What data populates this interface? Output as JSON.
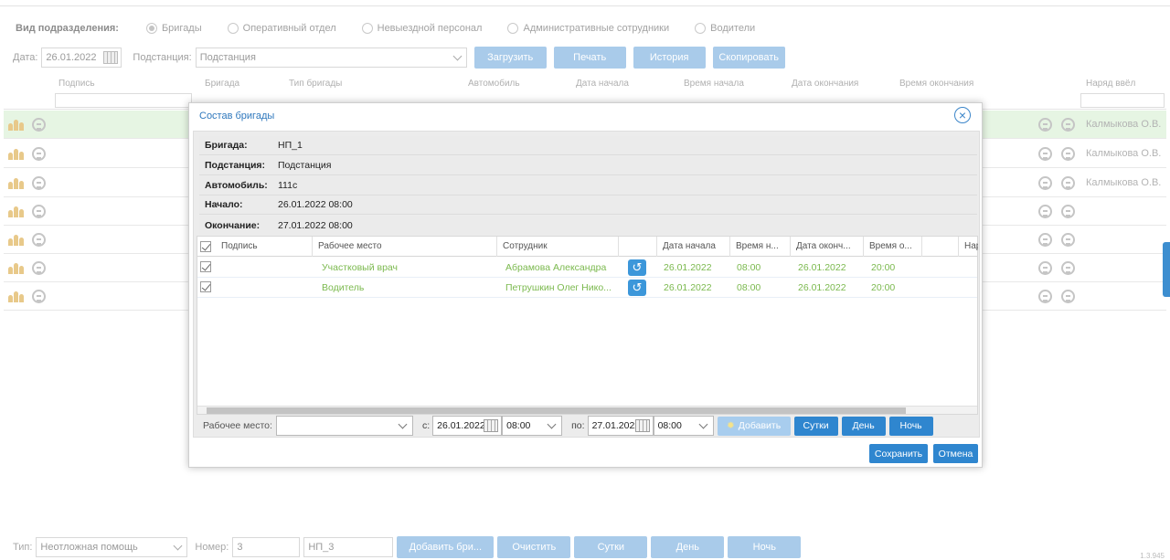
{
  "background": {
    "unit_type_label": "Вид подразделения:",
    "unit_types": [
      {
        "label": "Бригады",
        "selected": true
      },
      {
        "label": "Оперативный отдел",
        "selected": false
      },
      {
        "label": "Невыездной персонал",
        "selected": false
      },
      {
        "label": "Административные сотрудники",
        "selected": false
      },
      {
        "label": "Водители",
        "selected": false
      }
    ],
    "date_label": "Дата:",
    "date_value": "26.01.2022",
    "station_label": "Подстанция:",
    "station_value": "Подстанция",
    "buttons": {
      "load": "Загрузить",
      "print": "Печать",
      "history": "История",
      "copy": "Скопировать"
    },
    "columns": {
      "signature": "Подпись",
      "brigade": "Бригада",
      "brigade_type": "Тип бригады",
      "car": "Автомобиль",
      "start_date": "Дата начала",
      "start_time": "Время начала",
      "end_date": "Дата окончания",
      "end_time": "Время окончания",
      "issued_by": "Наряд ввёл"
    },
    "row_names": [
      "Калмыкова О.В.",
      "Калмыкова О.В.",
      "Калмыкова О.В.",
      "",
      "",
      "",
      ""
    ],
    "bottom": {
      "type_label": "Тип:",
      "type_value": "Неотложная помощь",
      "number_label": "Номер:",
      "number_value": "3",
      "code_value": "НП_3",
      "add_brigade": "Добавить бри...",
      "clear": "Очистить",
      "day24": "Сутки",
      "day": "День",
      "night": "Ночь"
    },
    "version": "1.3.945"
  },
  "modal": {
    "title": "Состав бригады",
    "info": [
      {
        "key": "Бригада:",
        "value": "НП_1"
      },
      {
        "key": "Подстанция:",
        "value": "Подстанция"
      },
      {
        "key": "Автомобиль:",
        "value": "111с"
      },
      {
        "key": "Начало:",
        "value": "26.01.2022 08:00"
      },
      {
        "key": "Окончание:",
        "value": "27.01.2022 08:00"
      }
    ],
    "table_headers": {
      "signature": "Подпись",
      "workplace": "Рабочее место",
      "employee": "Сотрудник",
      "start_date": "Дата начала",
      "start_time": "Время н...",
      "end_date": "Дата оконч...",
      "end_time": "Время о...",
      "extra": "Нар"
    },
    "rows": [
      {
        "checked": true,
        "workplace": "Участковый врач",
        "employee": "Абрамова Александра",
        "start_date": "26.01.2022",
        "start_time": "08:00",
        "end_date": "26.01.2022",
        "end_time": "20:00"
      },
      {
        "checked": true,
        "workplace": "Водитель",
        "employee": "Петрушкин Олег Нико...",
        "start_date": "26.01.2022",
        "start_time": "08:00",
        "end_date": "26.01.2022",
        "end_time": "20:00"
      }
    ],
    "controls": {
      "workplace_label": "Рабочее место:",
      "workplace_value": "",
      "from_label": "с:",
      "from_date": "26.01.2022",
      "from_time": "08:00",
      "to_label": "по:",
      "to_date": "27.01.2022",
      "to_time": "08:00",
      "add": "Добавить",
      "day24": "Сутки",
      "day": "День",
      "night": "Ночь"
    },
    "save": "Сохранить",
    "cancel": "Отмена"
  },
  "colors": {
    "accent": "#2f86cf",
    "row_text": "#7bb94e",
    "selected_row": "#e6f5e3"
  }
}
